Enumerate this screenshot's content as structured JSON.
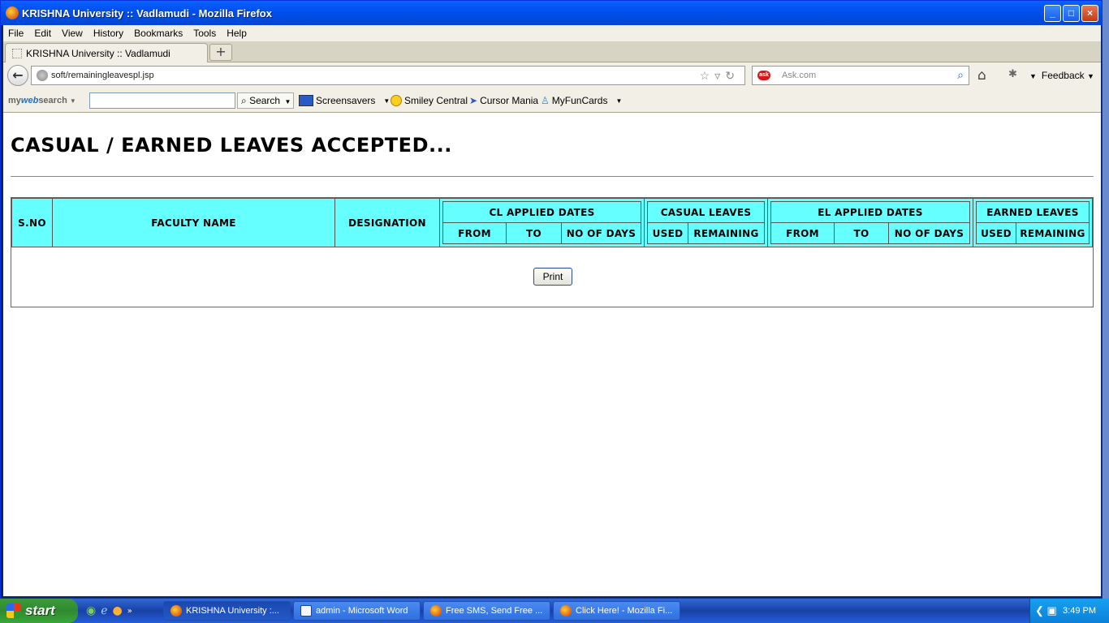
{
  "window": {
    "title": "KRISHNA University :: Vadlamudi - Mozilla Firefox",
    "buttons": [
      "minimize",
      "maximize",
      "close"
    ]
  },
  "menu": [
    "File",
    "Edit",
    "View",
    "History",
    "Bookmarks",
    "Tools",
    "Help"
  ],
  "tab": {
    "label": "KRISHNA University :: Vadlamudi",
    "new_tab": "+"
  },
  "nav": {
    "url": "soft/remainingleavespl.jsp",
    "search_placeholder": "Ask.com",
    "feedback": "Feedback"
  },
  "toolbar": {
    "brand_prefix": "my",
    "brand_bold": "web",
    "brand_suffix": "search",
    "search_button": "Search",
    "items": [
      "Screensavers",
      "Smiley Central",
      "Cursor Mania",
      "MyFunCards"
    ]
  },
  "page": {
    "title": "CASUAL / EARNED LEAVES ACCEPTED...",
    "table": {
      "sno": "S.NO",
      "faculty_name": "FACULTY NAME",
      "designation": "DESIGNATION",
      "cl_dates": {
        "group": "CL APPLIED DATES",
        "from": "FROM",
        "to": "TO",
        "days": "NO OF DAYS"
      },
      "casual": {
        "group": "CASUAL LEAVES",
        "used": "USED",
        "remaining": "REMAINING"
      },
      "el_dates": {
        "group": "EL APPLIED DATES",
        "from": "FROM",
        "to": "TO",
        "days": "NO OF DAYS"
      },
      "earned": {
        "group": "EARNED LEAVES",
        "used": "USED",
        "remaining": "REMAINING"
      }
    },
    "print_button": "Print"
  },
  "taskbar": {
    "start": "start",
    "items": [
      {
        "label": "KRISHNA University :...",
        "icon": "firefox-icon",
        "active": true
      },
      {
        "label": "admin - Microsoft Word",
        "icon": "word-icon",
        "active": false
      },
      {
        "label": "Free SMS, Send Free ...",
        "icon": "firefox-icon",
        "active": false
      },
      {
        "label": "Click Here! - Mozilla Fi...",
        "icon": "firefox-icon",
        "active": false
      }
    ],
    "clock": "3:49 PM"
  },
  "colors": {
    "table_header_bg": "#66ffff",
    "titlebar": "#0050ee",
    "taskbar": "#245edc",
    "start_button": "#3aa63a"
  }
}
